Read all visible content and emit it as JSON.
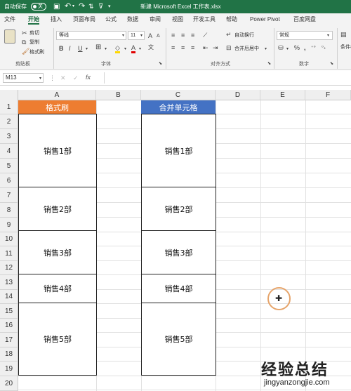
{
  "titlebar": {
    "autosave_label": "自动保存",
    "autosave_state": "关",
    "filename": "新建 Microsoft Excel 工作表.xlsx"
  },
  "tabs": [
    "文件",
    "开始",
    "插入",
    "页面布局",
    "公式",
    "数据",
    "审阅",
    "视图",
    "开发工具",
    "帮助",
    "Power Pivot",
    "百度网盘"
  ],
  "active_tab": "开始",
  "ribbon": {
    "clipboard": {
      "cut": "剪切",
      "copy": "复制",
      "format_painter": "格式刷",
      "group": "剪贴板"
    },
    "font": {
      "name": "等线",
      "size": "11",
      "group": "字体"
    },
    "alignment": {
      "wrap": "自动换行",
      "merge": "合并后居中",
      "group": "对齐方式"
    },
    "number": {
      "format": "常规",
      "group": "数字"
    },
    "styles_partial": "条件格"
  },
  "formula_bar": {
    "name_box": "M13",
    "formula": ""
  },
  "columns": [
    "A",
    "B",
    "C",
    "D",
    "E",
    "F"
  ],
  "rows": [
    "1",
    "2",
    "3",
    "4",
    "5",
    "6",
    "7",
    "8",
    "9",
    "10",
    "11",
    "12",
    "13",
    "14",
    "15",
    "16",
    "17",
    "18",
    "19",
    "20"
  ],
  "cells": {
    "A1": "格式刷",
    "C1": "合并单元格",
    "groups": [
      "销售1部",
      "销售2部",
      "销售3部",
      "销售4部",
      "销售5部"
    ]
  },
  "colors": {
    "excel_green": "#217346",
    "orange_header": "#ED7D31",
    "blue_header": "#4472C4"
  },
  "watermark": {
    "title": "经验总结",
    "url": "jingyanzongjie.com"
  }
}
